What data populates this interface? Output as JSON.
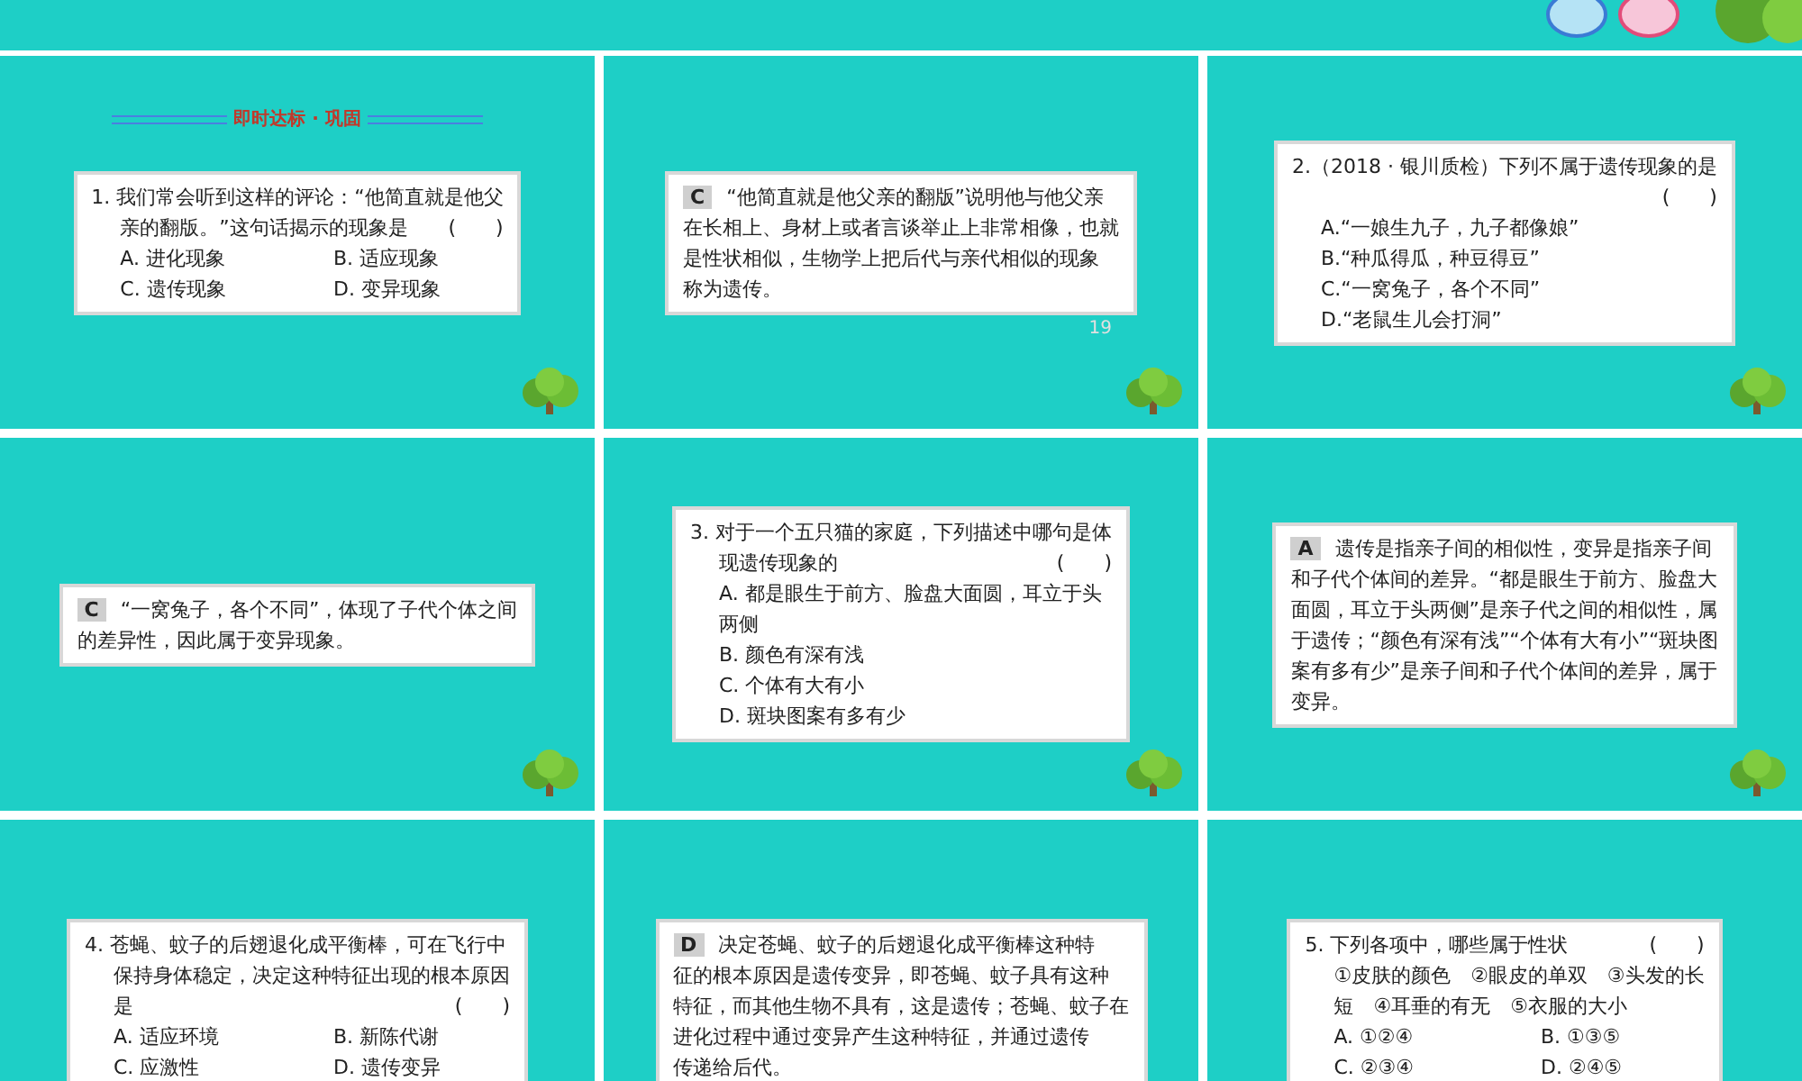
{
  "slides": [
    {
      "header": "即时达标 · 巩固",
      "tree": true,
      "card": {
        "kind": "question-grid",
        "stem": [
          {
            "text": "1. 我们常会听到这样的评论：“他简直就是他父"
          },
          {
            "text": "亲的翻版。”这句话揭示的现象是",
            "blank": "(　　)"
          }
        ],
        "options": [
          "A. 进化现象",
          "B. 适应现象",
          "C. 遗传现象",
          "D. 变异现象"
        ]
      }
    },
    {
      "tree": true,
      "page_number": "19",
      "card": {
        "kind": "answer",
        "letter": "C",
        "lines": [
          "“他简直就是他父亲的翻版”说明他与他父亲",
          "在长相上、身材上或者言谈举止上非常相像，也就",
          "是性状相似，生物学上把后代与亲代相似的现象",
          "称为遗传。"
        ]
      }
    },
    {
      "tree": true,
      "card": {
        "kind": "question-list",
        "stem": [
          {
            "text": "2.（2018 · 银川质检）下列不属于遗传现象的是"
          },
          {
            "blank": "(　　)"
          }
        ],
        "options": [
          "A.“一娘生九子，九子都像娘”",
          "B.“种瓜得瓜，种豆得豆”",
          "C.“一窝兔子，各个不同”",
          "D.“老鼠生儿会打洞”"
        ]
      }
    },
    {
      "tree": true,
      "card": {
        "kind": "answer",
        "letter": "C",
        "lines": [
          "“一窝兔子，各个不同”，体现了子代个体之间",
          "的差异性，因此属于变异现象。"
        ]
      }
    },
    {
      "tree": true,
      "card": {
        "kind": "question-list",
        "stem": [
          {
            "text": "3. 对于一个五只猫的家庭，下列描述中哪句是体"
          },
          {
            "text": "现遗传现象的",
            "blank": "(　　)"
          }
        ],
        "options": [
          "A. 都是眼生于前方、脸盘大面圆，耳立于头",
          "两侧",
          "B. 颜色有深有浅",
          "C. 个体有大有小",
          "D. 斑块图案有多有少"
        ]
      }
    },
    {
      "tree": true,
      "card": {
        "kind": "answer",
        "letter": "A",
        "lines": [
          "遗传是指亲子间的相似性，变异是指亲子间",
          "和子代个体间的差异。“都是眼生于前方、脸盘大",
          "面圆，耳立于头两侧”是亲子代之间的相似性，属",
          "于遗传；“颜色有深有浅”“个体有大有小”“斑块图",
          "案有多有少”是亲子间和子代个体间的差异，属于",
          "变异。"
        ]
      }
    },
    {
      "tree": false,
      "card": {
        "kind": "question-grid",
        "stem": [
          {
            "text": "4. 苍蝇、蚊子的后翅退化成平衡棒，可在飞行中"
          },
          {
            "text": "保持身体稳定，决定这种特征出现的根本原因"
          },
          {
            "text": "是",
            "blank": "(　　)"
          }
        ],
        "options": [
          "A. 适应环境",
          "B. 新陈代谢",
          "C. 应激性",
          "D. 遗传变异"
        ]
      }
    },
    {
      "tree": false,
      "card": {
        "kind": "answer",
        "letter": "D",
        "lines": [
          "决定苍蝇、蚊子的后翅退化成平衡棒这种特",
          "征的根本原因是遗传变异，即苍蝇、蚊子具有这种",
          "特征，而其他生物不具有，这是遗传；苍蝇、蚊子在",
          "进化过程中通过变异产生这种特征，并通过遗传",
          "传递给后代。"
        ]
      }
    },
    {
      "tree": false,
      "card": {
        "kind": "question-grid",
        "stem": [
          {
            "text": "5. 下列各项中，哪些属于性状",
            "blank": "(　　)"
          },
          {
            "text": "①皮肤的颜色　②眼皮的单双　③头发的长"
          },
          {
            "text": "短　④耳垂的有无　⑤衣服的大小"
          }
        ],
        "options": [
          "A. ①②④",
          "B. ①③⑤",
          "C. ②③④",
          "D. ②④⑤"
        ]
      }
    }
  ]
}
